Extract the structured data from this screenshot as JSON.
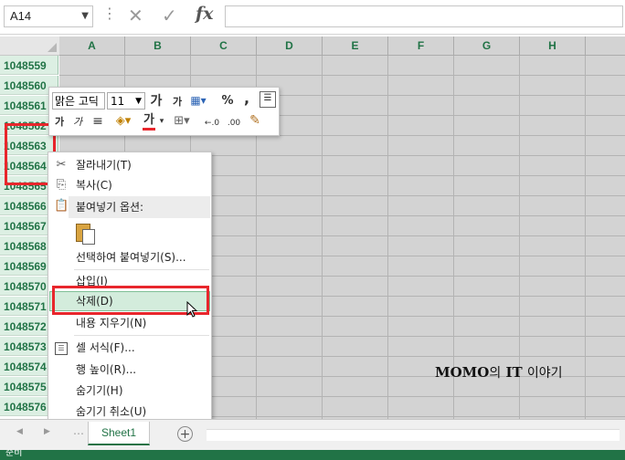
{
  "formula_bar": {
    "name_box": "A14",
    "cancel_icon": "cancel-icon",
    "enter_icon": "check-icon",
    "fx_label": "fx"
  },
  "columns": [
    "A",
    "B",
    "C",
    "D",
    "E",
    "F",
    "G",
    "H"
  ],
  "rows": [
    "1048559",
    "1048560",
    "1048561",
    "1048562",
    "1048563",
    "1048564",
    "1048565",
    "1048566",
    "1048567",
    "1048568",
    "1048569",
    "1048570",
    "1048571",
    "1048572",
    "1048573",
    "1048574",
    "1048575",
    "1048576"
  ],
  "mini_toolbar": {
    "font_name": "맑은 고딕",
    "font_size": "11",
    "grow_font": "가",
    "shrink_font": "가",
    "percent": "%",
    "comma": ",",
    "bold": "가",
    "italic": "가",
    "font_color": "가",
    "inc_decimal": "←.0",
    "dec_decimal": ".00"
  },
  "context_menu": {
    "items": [
      {
        "label": "잘라내기(T)",
        "icon": "scissors-icon"
      },
      {
        "label": "복사(C)",
        "icon": "copy-icon"
      },
      {
        "label": "붙여넣기 옵션:",
        "icon": "paste-icon"
      },
      {
        "label": "선택하여 붙여넣기(S)...",
        "icon": ""
      },
      {
        "label": "삽입(I)",
        "icon": ""
      },
      {
        "label": "삭제(D)",
        "icon": ""
      },
      {
        "label": "내용 지우기(N)",
        "icon": ""
      },
      {
        "label": "셀 서식(F)...",
        "icon": "format-cells-icon"
      },
      {
        "label": "행 높이(R)...",
        "icon": ""
      },
      {
        "label": "숨기기(H)",
        "icon": ""
      },
      {
        "label": "숨기기 취소(U)",
        "icon": ""
      }
    ]
  },
  "sheet_tabs": [
    "Sheet1"
  ],
  "status": "준비",
  "watermark": {
    "brand": "MOMO",
    "suffix": "의",
    "it": "IT",
    "tail": "이야기"
  },
  "colors": {
    "accent": "#217346",
    "highlight": "#e8262c",
    "selected_header_bg": "#dcefe3"
  }
}
